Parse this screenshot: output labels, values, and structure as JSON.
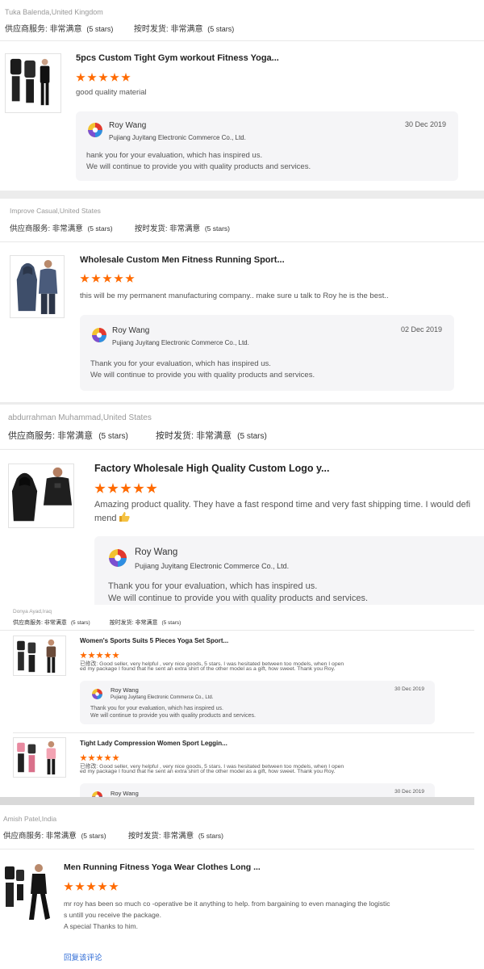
{
  "colors": {
    "star": "#ff6a00",
    "link": "#2e6bd6",
    "reply_bg": "#f5f5f7"
  },
  "rating_labels": {
    "supplier": "供应商服务:",
    "supplier_value": "非常满意",
    "supplier_stars": "(5 stars)",
    "shipping": "按时发货:",
    "shipping_value": "非常满意",
    "shipping_stars": "(5 stars)"
  },
  "reply_common": {
    "name": "Roy Wang",
    "company": "Pujiang Juyitang Electronic Commerce Co., Ltd.",
    "line2": "We will continue to provide you with quality products and services."
  },
  "reviews": [
    {
      "reviewer": "Tuka Balenda,United Kingdom",
      "product_title": "5pcs Custom Tight Gym workout Fitness Yoga...",
      "text": "good quality material",
      "reply_date": "30 Dec 2019",
      "reply_line1": "hank you for your evaluation, which has inspired us.",
      "image_icon": "tracksuit-set-black"
    },
    {
      "reviewer": "Improve Casual,United States",
      "product_title": "Wholesale Custom Men Fitness Running Sport...",
      "text": "this will be my permanent manufacturing company.. make sure u talk to Roy he is the best..",
      "reply_date": "02 Dec 2019",
      "reply_line1": "Thank you for your evaluation, which has inspired us.",
      "image_icon": "hoodie-blue"
    },
    {
      "reviewer": "abdurrahman Muhammad,United States",
      "product_title": "Factory Wholesale High Quality Custom Logo y...",
      "text_line1": "Amazing product quality. They have a fast respond time and very fast shipping time. I would defi",
      "text_line2": "mend",
      "reply_line1": "Thank you for your evaluation, which has inspired us.",
      "image_icon": "hoodie-black"
    },
    {
      "reviewer": "Donya Ayad,Iraq",
      "items": [
        {
          "product_title": "Women's Sports Suits 5 Pieces Yoga Set Sport...",
          "text_line1": "已修改: Good seller, very helpful , very nice goods, 5 stars. I was hesitated between too models, when I open",
          "text_line2": "ed my package I found that he sent an extra shirt of the other model as a gift, how sweet. Thank you Roy.",
          "reply_date": "30 Dec 2019",
          "reply_line1": "Thank you for your evaluation, which has inspired us.",
          "image_icon": "women-yoga-set"
        },
        {
          "product_title": "Tight Lady Compression Women Sport Leggin...",
          "text_line1": "已修改: Good seller, very helpful , very nice goods, 5 stars. I was hesitated between too models, when I open",
          "text_line2": "ed my package I found that he sent an extra shirt of the other model as a gift, how sweet. Thank you Roy.",
          "reply_date": "30 Dec 2019",
          "image_icon": "women-leggings-pink"
        }
      ]
    },
    {
      "reviewer": "Amish Patel,India",
      "product_title": "Men Running Fitness Yoga Wear Clothes Long ...",
      "text_line1": "mr roy has been so much co -operative be it anything to help. from bargaining to even managing the logistic",
      "text_line2": "s untill you receive the package.",
      "text_line3": "A special Thanks to him.",
      "reply_link": "回复该评论",
      "image_icon": "running-set-black"
    }
  ]
}
